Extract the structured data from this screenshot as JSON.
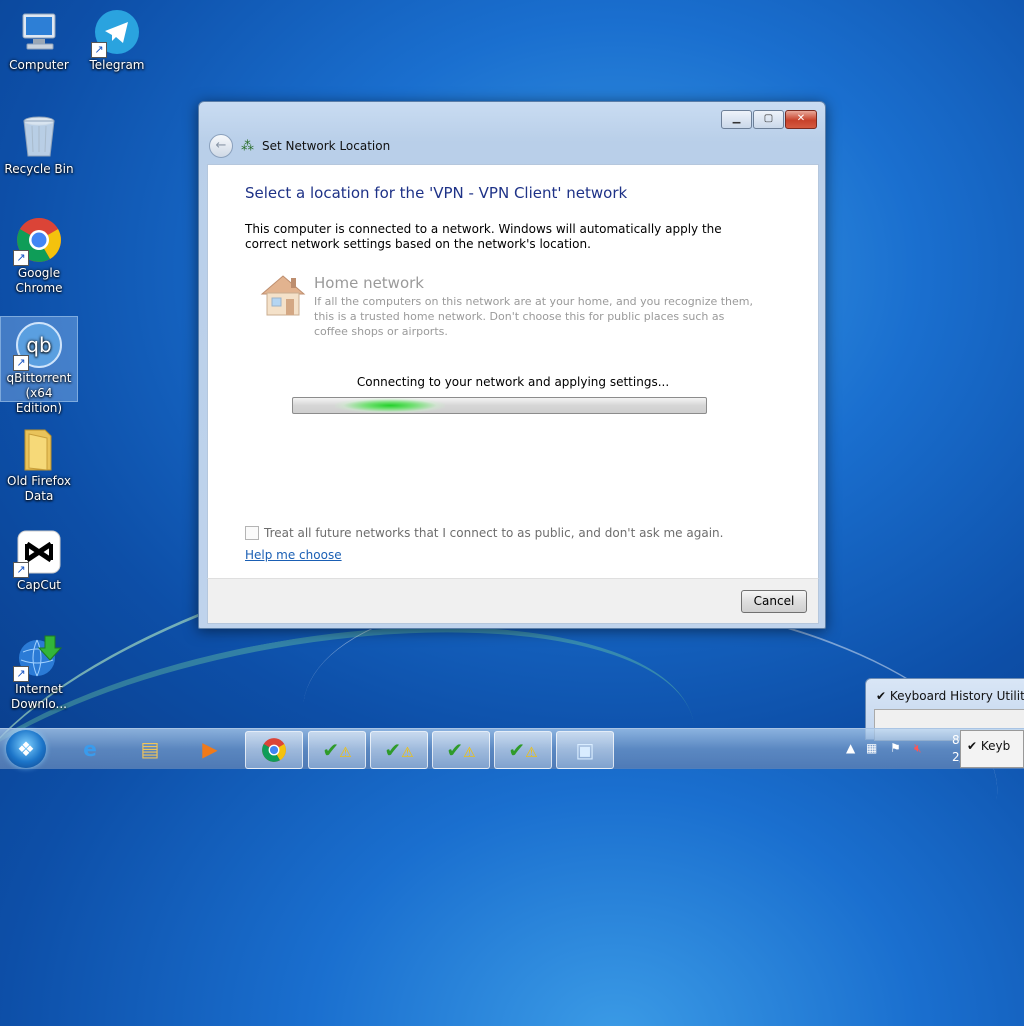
{
  "desktop": {
    "icons": [
      {
        "label": "Computer",
        "icon": "computer-icon"
      },
      {
        "label": "Telegram",
        "icon": "telegram-icon"
      },
      {
        "label": "Recycle Bin",
        "icon": "recycle-bin-icon"
      },
      {
        "label": "Google Chrome",
        "icon": "chrome-icon"
      },
      {
        "label": "qBittorrent (x64 Edition)",
        "icon": "qbittorrent-icon"
      },
      {
        "label": "Old Firefox Data",
        "icon": "folder-icon"
      },
      {
        "label": "CapCut",
        "icon": "capcut-icon"
      },
      {
        "label": "Internet Downlo...",
        "icon": "internet-download-manager-icon"
      }
    ]
  },
  "dialog": {
    "title": "Set Network Location",
    "heading": "Select a location for the 'VPN - VPN Client' network",
    "description": "This computer is connected to a network. Windows will automatically apply the correct network settings based on the network's location.",
    "option": {
      "title": "Home network",
      "description": "If all the computers on this network are at your home, and you recognize them, this is a trusted home network.  Don't choose this for public places such as coffee shops or airports."
    },
    "status": "Connecting to your network and applying settings...",
    "progress": "indeterminate",
    "checkbox_label": "Treat all future networks that I connect to as public, and don't ask me again.",
    "checkbox_checked": false,
    "help_link": "Help me choose",
    "cancel_label": "Cancel"
  },
  "background_window": {
    "title": "Keyboard History Utility"
  },
  "taskbar": {
    "pinned": [
      "start-orb",
      "internet-explorer-icon",
      "file-explorer-icon",
      "media-player-icon",
      "chrome-icon",
      "warning-app-icon",
      "warning-app-icon",
      "warning-app-icon",
      "warning-app-icon",
      "network-settings-icon"
    ],
    "clock_time": "8:",
    "clock_date": "2/",
    "popup_label": "Keyb"
  },
  "colors": {
    "heading": "#1e3287",
    "link": "#1a5fb4",
    "progress_glow": "#22d02a",
    "close_button": "#c7412a"
  }
}
